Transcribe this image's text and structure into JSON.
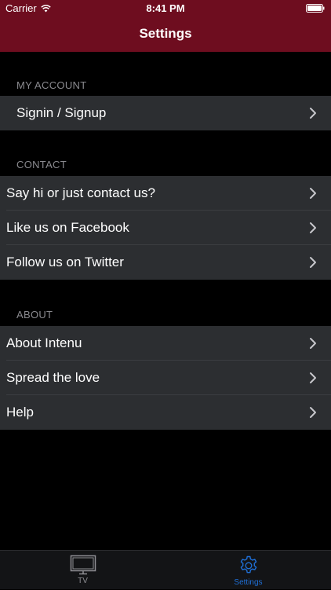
{
  "status_bar": {
    "carrier": "Carrier",
    "time": "8:41 PM"
  },
  "nav": {
    "title": "Settings"
  },
  "sections": {
    "account": {
      "header": "MY ACCOUNT",
      "items": [
        {
          "label": "Signin / Signup"
        }
      ]
    },
    "contact": {
      "header": "CONTACT",
      "items": [
        {
          "label": "Say hi or just contact us?"
        },
        {
          "label": "Like us on Facebook"
        },
        {
          "label": "Follow us on Twitter"
        }
      ]
    },
    "about": {
      "header": "ABOUT",
      "items": [
        {
          "label": "About Intenu"
        },
        {
          "label": "Spread the love"
        },
        {
          "label": "Help"
        }
      ]
    }
  },
  "tabbar": {
    "tabs": [
      {
        "label": "TV",
        "icon": "tv-icon",
        "selected": false
      },
      {
        "label": "Settings",
        "icon": "gear-icon",
        "selected": true
      }
    ]
  },
  "colors": {
    "nav_bar": "#6e0d1f",
    "cell_background": "#2c2e31",
    "section_header_text": "#8a8a8f",
    "tab_selected": "#1f6fd6",
    "tab_unselected": "#8e8e93"
  }
}
